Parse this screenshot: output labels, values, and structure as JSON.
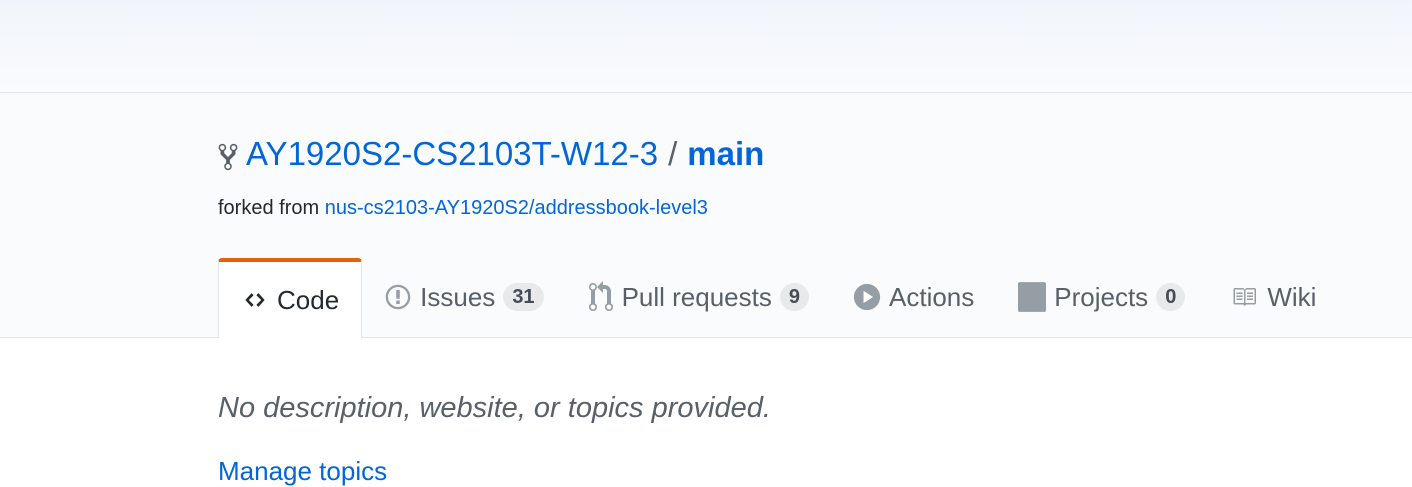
{
  "repo": {
    "owner": "AY1920S2-CS2103T-W12-3",
    "separator": "/",
    "name": "main",
    "forked_from_label": "forked from",
    "forked_from_link": "nus-cs2103-AY1920S2/addressbook-level3"
  },
  "tabs": [
    {
      "label": "Code",
      "icon": "code-icon",
      "selected": true
    },
    {
      "label": "Issues",
      "icon": "issue-opened-icon",
      "counter": "31"
    },
    {
      "label": "Pull requests",
      "icon": "git-pull-request-icon",
      "counter": "9"
    },
    {
      "label": "Actions",
      "icon": "play-icon"
    },
    {
      "label": "Projects",
      "icon": "project-icon",
      "counter": "0"
    },
    {
      "label": "Wiki",
      "icon": "book-icon"
    }
  ],
  "colors": {
    "link": "#0366d6",
    "selected_tab_accent": "#e36209",
    "muted": "#586069"
  },
  "about": {
    "description": "No description, website, or topics provided.",
    "manage_topics": "Manage topics"
  }
}
